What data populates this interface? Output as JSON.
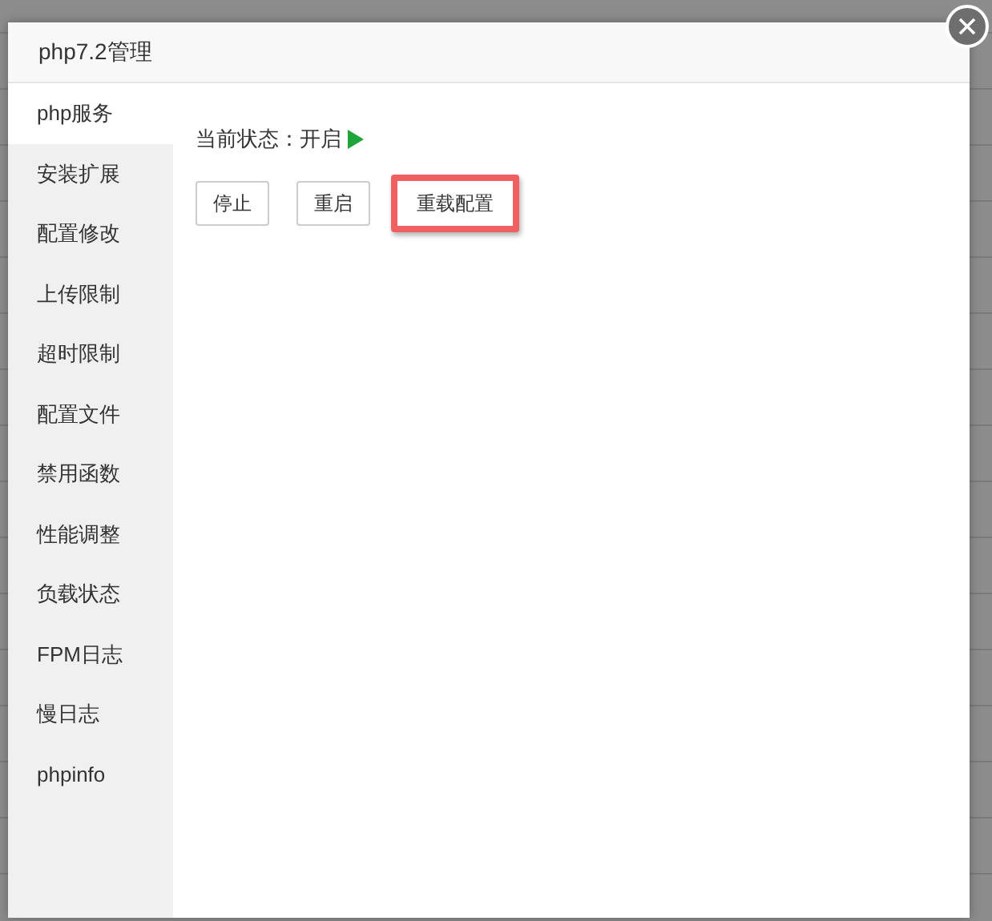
{
  "dialog": {
    "title": "php7.2管理"
  },
  "sidebar": {
    "items": [
      {
        "label": "php服务",
        "selected": true
      },
      {
        "label": "安装扩展",
        "selected": false
      },
      {
        "label": "配置修改",
        "selected": false
      },
      {
        "label": "上传限制",
        "selected": false
      },
      {
        "label": "超时限制",
        "selected": false
      },
      {
        "label": "配置文件",
        "selected": false
      },
      {
        "label": "禁用函数",
        "selected": false
      },
      {
        "label": "性能调整",
        "selected": false
      },
      {
        "label": "负载状态",
        "selected": false
      },
      {
        "label": "FPM日志",
        "selected": false
      },
      {
        "label": "慢日志",
        "selected": false
      },
      {
        "label": "phpinfo",
        "selected": false
      }
    ]
  },
  "status": {
    "label": "当前状态：开启",
    "running": true
  },
  "buttons": [
    {
      "label": "停止",
      "highlighted": false
    },
    {
      "label": "重启",
      "highlighted": false
    },
    {
      "label": "重载配置",
      "highlighted": true
    }
  ]
}
